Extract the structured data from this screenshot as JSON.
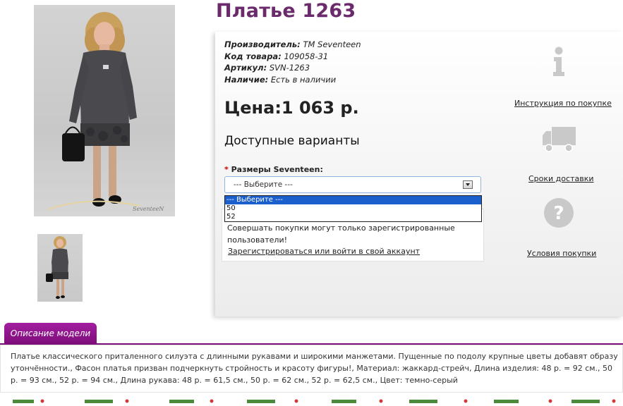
{
  "product": {
    "title": "Платье 1263",
    "manufacturer_label": "Производитель:",
    "manufacturer_value": "TM Seventeen",
    "code_label": "Код товара:",
    "code_value": "109058-31",
    "sku_label": "Артикул:",
    "sku_value": "SVN-1263",
    "availability_label": "Наличие:",
    "availability_value": "Есть в наличии",
    "price": "Цена:1 063 р."
  },
  "options": {
    "heading": "Доступные варианты",
    "required_mark": "*",
    "size_label": "Размеры Seventeen:",
    "select_value": "--- Выберите ---",
    "dropdown_items": [
      "--- Выберите ---",
      "50",
      "52"
    ]
  },
  "registration": {
    "notice": "Совершать покупки могут только зарегистрированные пользователи!",
    "link": "Зарегистрироваться или войти в свой аккаунт"
  },
  "sidebar": {
    "links": [
      {
        "label": "Инструкция по покупке",
        "icon": "info-icon"
      },
      {
        "label": "Сроки доставки",
        "icon": "truck-icon"
      },
      {
        "label": "Условия покупки",
        "icon": "question-icon"
      }
    ],
    "icon_color": "#c9c9c9"
  },
  "description": {
    "tab_label": "Описание модели",
    "text": "Платье классического приталенного силуэта с длинными рукавами и широкими манжетами. Пущенные по подолу крупные цветы добавят образу утончённости., Фасон платья призван подчеркнуть стройность и красоту фигуры!, Материал: жаккард-стрейч, Длина изделия: 48 р. = 92 см., 50 р. = 93 см., 52 р. = 94 см., Длина рукава: 48 р. = 61,5 см., 50 р. = 62 см., 52 р. = 62,5 см., Цвет: темно-серый"
  },
  "photo": {
    "watermark": "SeventeeN"
  },
  "colors": {
    "title": "#6b2a6b",
    "tab": "#8a1487",
    "dropdown_selected": "#1a5fcb"
  }
}
